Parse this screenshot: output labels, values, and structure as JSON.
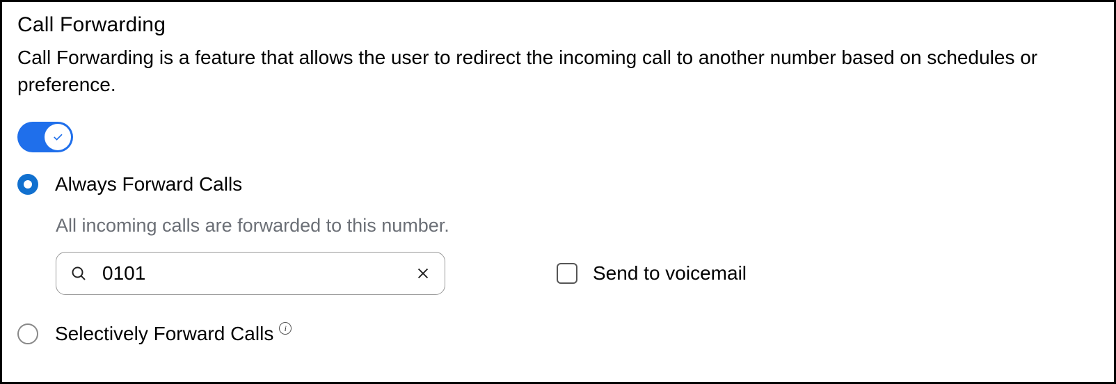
{
  "panel": {
    "title": "Call Forwarding",
    "description": "Call Forwarding is a feature that allows the user to redirect the incoming call to another number based on schedules or preference."
  },
  "toggle": {
    "enabled": true
  },
  "options": {
    "always": {
      "label": "Always Forward Calls",
      "selected": true,
      "hint": "All incoming calls are forwarded to this number.",
      "number_value": "0101",
      "voicemail_label": "Send to voicemail",
      "voicemail_checked": false
    },
    "selective": {
      "label": "Selectively Forward Calls",
      "selected": false
    }
  },
  "icons": {
    "info_glyph": "i"
  }
}
